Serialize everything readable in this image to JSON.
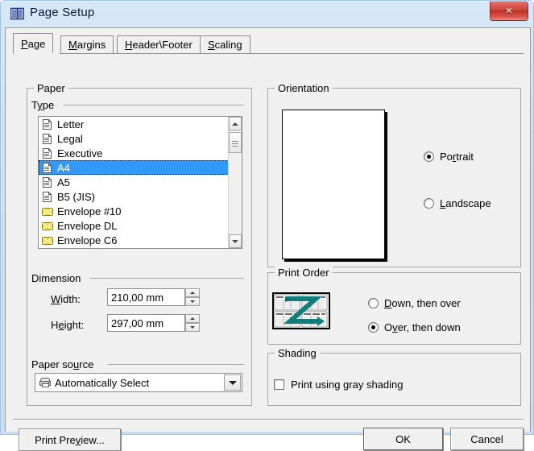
{
  "window": {
    "title": "Page Setup",
    "icon": "book-icon",
    "close_label": "×",
    "frame_color": "#cde1f5",
    "accent_selection": "#3399ff"
  },
  "tabs": [
    {
      "label": "Page",
      "accel": "P",
      "active": true
    },
    {
      "label": "Margins",
      "accel": "M",
      "active": false
    },
    {
      "label": "Header\\Footer",
      "accel": "H",
      "active": false
    },
    {
      "label": "Scaling",
      "accel": "S",
      "active": false
    }
  ],
  "paper": {
    "group_label": "Paper",
    "type_label": "Type",
    "type_accel": "y",
    "items": [
      {
        "label": "Letter",
        "icon": "document-icon",
        "selected": false
      },
      {
        "label": "Legal",
        "icon": "document-icon",
        "selected": false
      },
      {
        "label": "Executive",
        "icon": "document-icon",
        "selected": false
      },
      {
        "label": "A4",
        "icon": "document-icon",
        "selected": true
      },
      {
        "label": "A5",
        "icon": "document-icon",
        "selected": false
      },
      {
        "label": "B5 (JIS)",
        "icon": "document-icon",
        "selected": false
      },
      {
        "label": "Envelope #10",
        "icon": "envelope-icon",
        "selected": false
      },
      {
        "label": "Envelope DL",
        "icon": "envelope-icon",
        "selected": false
      },
      {
        "label": "Envelope C6",
        "icon": "envelope-icon",
        "selected": false
      }
    ],
    "selected_type": "A4"
  },
  "dimension": {
    "group_label": "Dimension",
    "width_label": "Width:",
    "width_accel": "W",
    "width_value": "210,00 mm",
    "height_label": "Height:",
    "height_accel": "e",
    "height_value": "297,00 mm"
  },
  "paper_source": {
    "label": "Paper source",
    "accel": "u",
    "selected": "Automatically Select",
    "icon": "printer-icon"
  },
  "orientation": {
    "group_label": "Orientation",
    "options": [
      {
        "label": "Portrait",
        "accel": "r",
        "selected": true
      },
      {
        "label": "Landscape",
        "accel": "L",
        "selected": false
      }
    ],
    "preview": "portrait-page-preview"
  },
  "print_order": {
    "group_label": "Print Order",
    "icon": "print-order-z-icon",
    "options": [
      {
        "label": "Down, then over",
        "accel": "D",
        "selected": false
      },
      {
        "label": "Over, then down",
        "accel": "v",
        "selected": true
      }
    ]
  },
  "shading": {
    "group_label": "Shading",
    "checkbox_label": "Print using gray shading",
    "accel": "g",
    "checked": false
  },
  "buttons": {
    "print_preview": "Print Preview...",
    "print_preview_accel": "v",
    "ok": "OK",
    "cancel": "Cancel"
  }
}
